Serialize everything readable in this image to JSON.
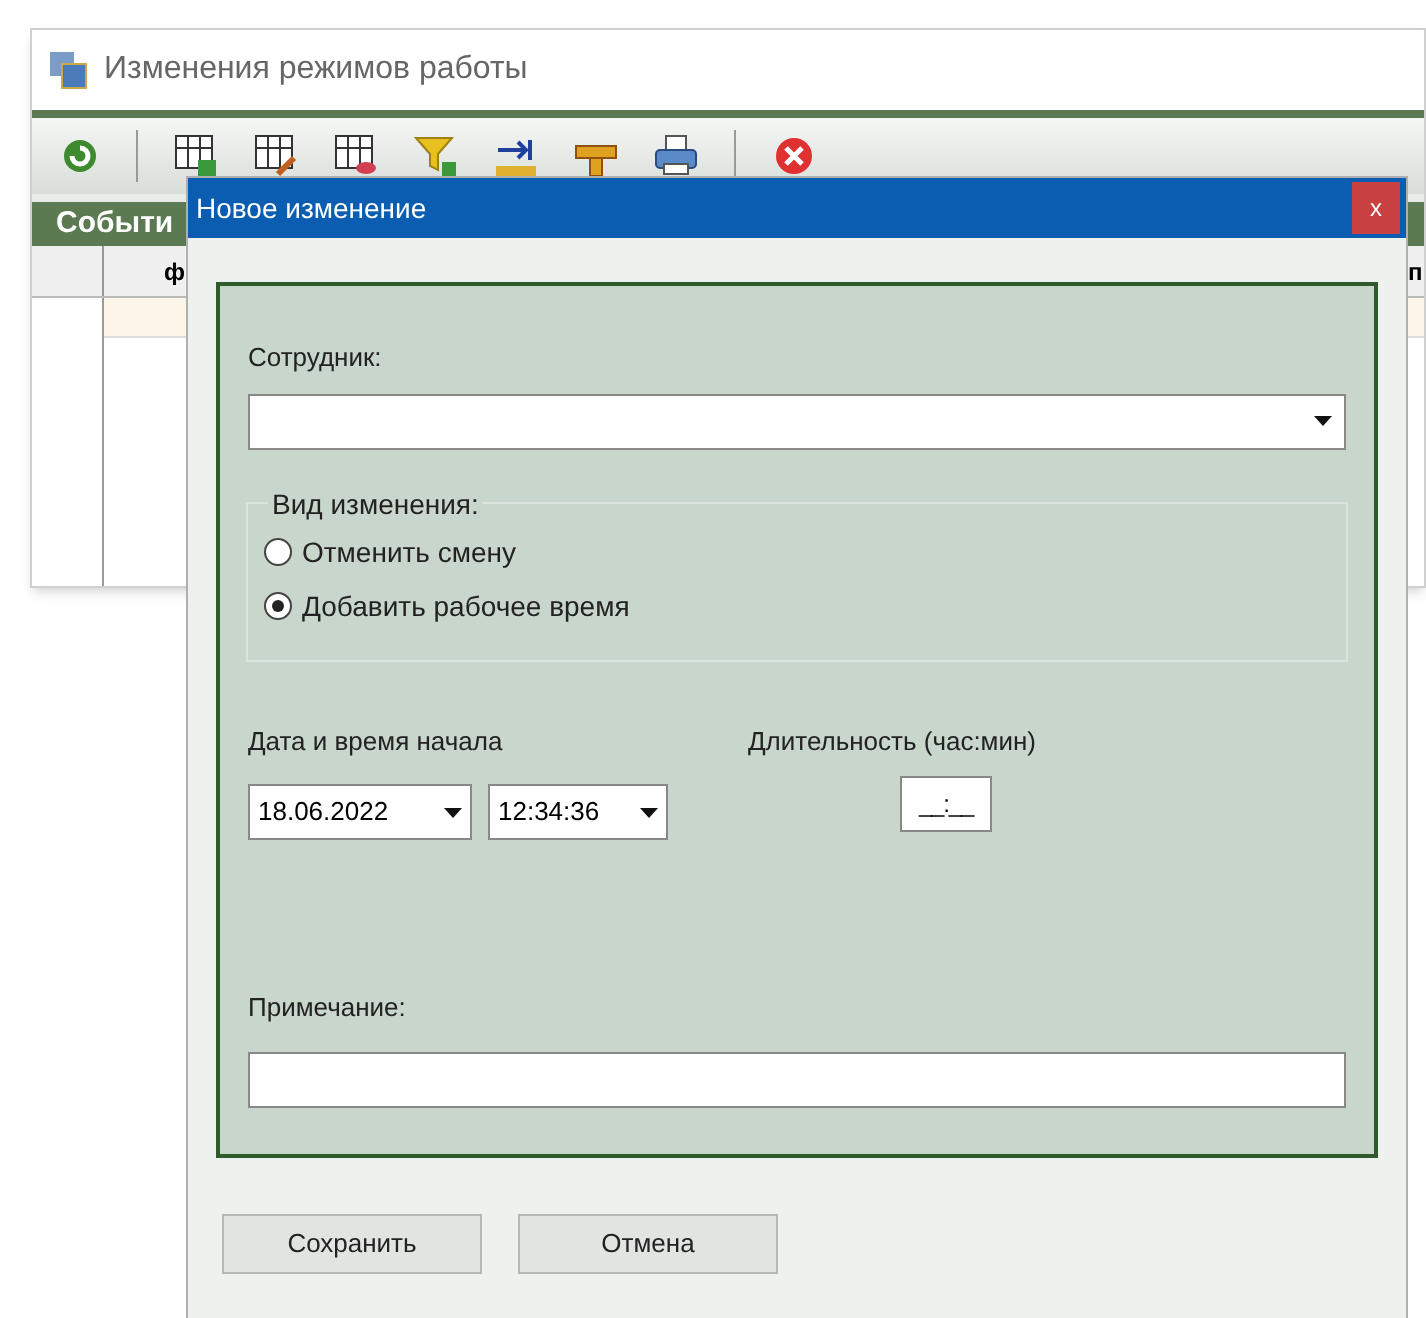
{
  "window": {
    "title": "Изменения режимов работы"
  },
  "tab": {
    "label": "Событи"
  },
  "table": {
    "columns": [
      "ф",
      "п"
    ]
  },
  "dialog": {
    "title": "Новое изменение",
    "close": "x",
    "employee": {
      "label": "Сотрудник:"
    },
    "change_type": {
      "label": "Вид изменения:",
      "options": [
        {
          "label": "Отменить смену",
          "selected": false
        },
        {
          "label": "Добавить рабочее время",
          "selected": true
        }
      ]
    },
    "start": {
      "label": "Дата и время начала",
      "date": "18.06.2022",
      "time": "12:34:36"
    },
    "duration": {
      "label": "Длительность (час:мин)",
      "value": "__:__"
    },
    "note": {
      "label": "Примечание:"
    },
    "buttons": [
      "Сохранить",
      "Отмена"
    ]
  }
}
